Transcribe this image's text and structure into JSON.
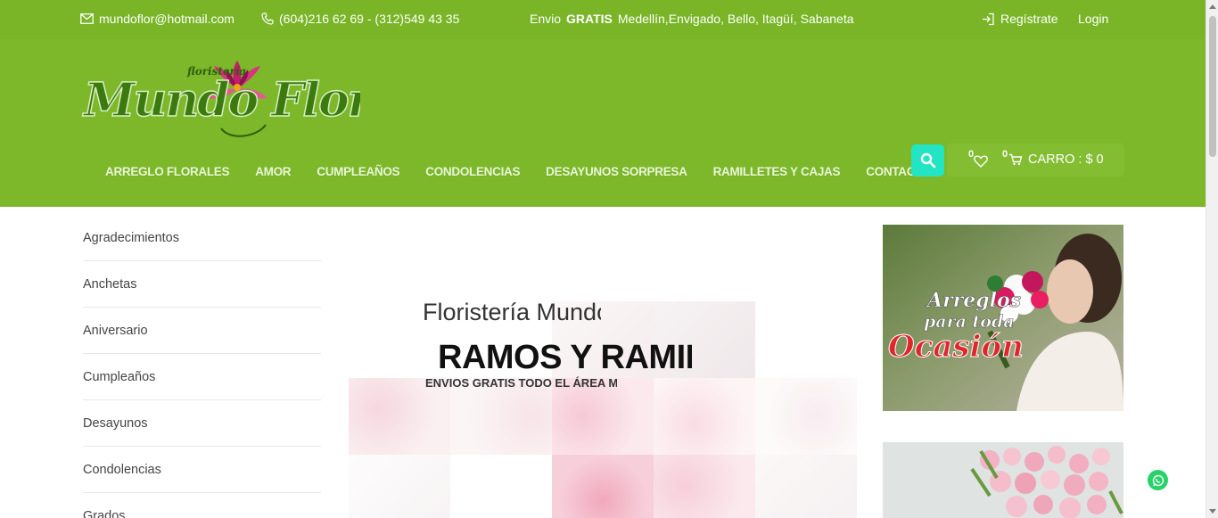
{
  "topbar": {
    "email": "mundoflor@hotmail.com",
    "phones": "(604)216 62 69 - (312)549 43 35",
    "shipping_prefix": "Envio",
    "shipping_bold": "GRATIS",
    "shipping_rest": "Medellín,Envigado, Bello, Itagüí, Sabaneta",
    "register": "Regístrate",
    "login": "Login"
  },
  "logo": {
    "small_text": "floristería",
    "brand_text": "Mundo Flor"
  },
  "nav": [
    "ARREGLO FLORALES",
    "AMOR",
    "CUMPLEAÑOS",
    "CONDOLENCIAS",
    "DESAYUNOS SORPRESA",
    "RAMILLETES Y CAJAS",
    "CONTACTO"
  ],
  "cart": {
    "wishlist_count": "0",
    "cart_count": "0",
    "label": "CARRO : $ 0"
  },
  "categories": [
    "Agradecimientos",
    "Anchetas",
    "Aniversario",
    "Cumpleaños",
    "Desayunos",
    "Condolencias",
    "Grados"
  ],
  "slider": {
    "line1": "Floristería Mundo Flor",
    "line2": "RAMOS Y RAMILLETES",
    "line3": "ENVIOS GRATIS TODO EL ÁREA METROPOLITANA"
  },
  "banner1": {
    "line1": "Arreglos",
    "line2": "para toda",
    "line3": "Ocasión"
  },
  "colors": {
    "topbar": "#79b527",
    "header": "#7cb82a",
    "search": "#23e5c3",
    "whatsapp": "#25d366"
  }
}
